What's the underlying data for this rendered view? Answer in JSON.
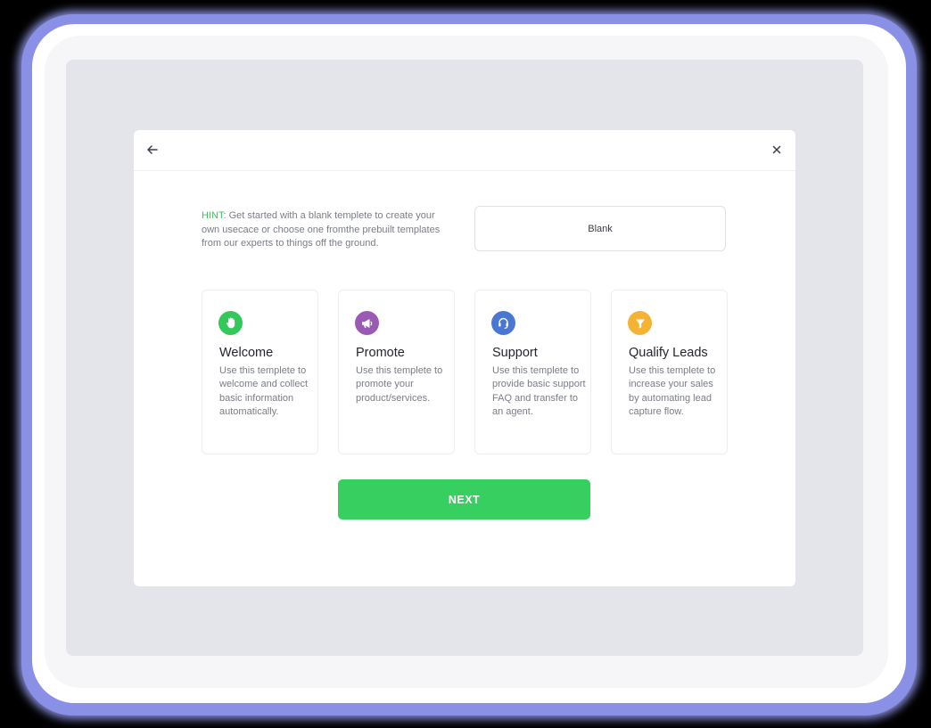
{
  "dialog": {
    "hint_label": "HINT",
    "hint_text": ": Get started with a blank templete to create your own usecace or choose one fromthe prebuilt templates from our experts to things off the ground.",
    "blank_label": "Blank",
    "next_label": "NEXT"
  },
  "templates": [
    {
      "title": "Welcome",
      "description": "Use this templete to welcome and collect basic information automatically.",
      "icon": "hand-icon",
      "color": "#34c759"
    },
    {
      "title": "Promote",
      "description": "Use this templete to promote your product/services.",
      "icon": "megaphone-icon",
      "color": "#9b59b6"
    },
    {
      "title": "Support",
      "description": "Use this templete to provide basic support FAQ and transfer to an agent.",
      "icon": "headset-icon",
      "color": "#4a77d4"
    },
    {
      "title": "Qualify Leads",
      "description": "Use this templete to increase your sales by automating lead capture flow.",
      "icon": "funnel-icon",
      "color": "#f5b335"
    }
  ],
  "colors": {
    "accent": "#37d060",
    "hint": "#3fc35a"
  }
}
